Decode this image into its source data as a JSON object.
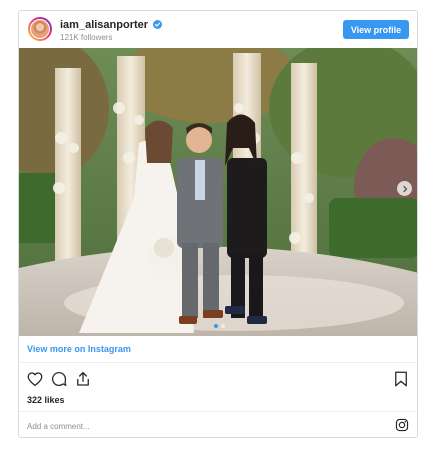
{
  "header": {
    "username": "iam_alisanporter",
    "followers": "121K followers",
    "view_profile_label": "View profile"
  },
  "photo": {
    "alt": "Wedding photo: bride, groom and officiant in a garden",
    "slide_count": 2,
    "active_slide": 1
  },
  "footer": {
    "view_more_label": "View more on Instagram",
    "likes": "322 likes",
    "comment_placeholder": "Add a comment..."
  },
  "colors": {
    "accent": "#3897f0",
    "border": "#dbdbdb",
    "muted": "#8e8e8e"
  },
  "icons": [
    "verified-badge-icon",
    "heart-icon",
    "comment-icon",
    "share-icon",
    "bookmark-icon",
    "chevron-right-icon",
    "instagram-icon"
  ]
}
